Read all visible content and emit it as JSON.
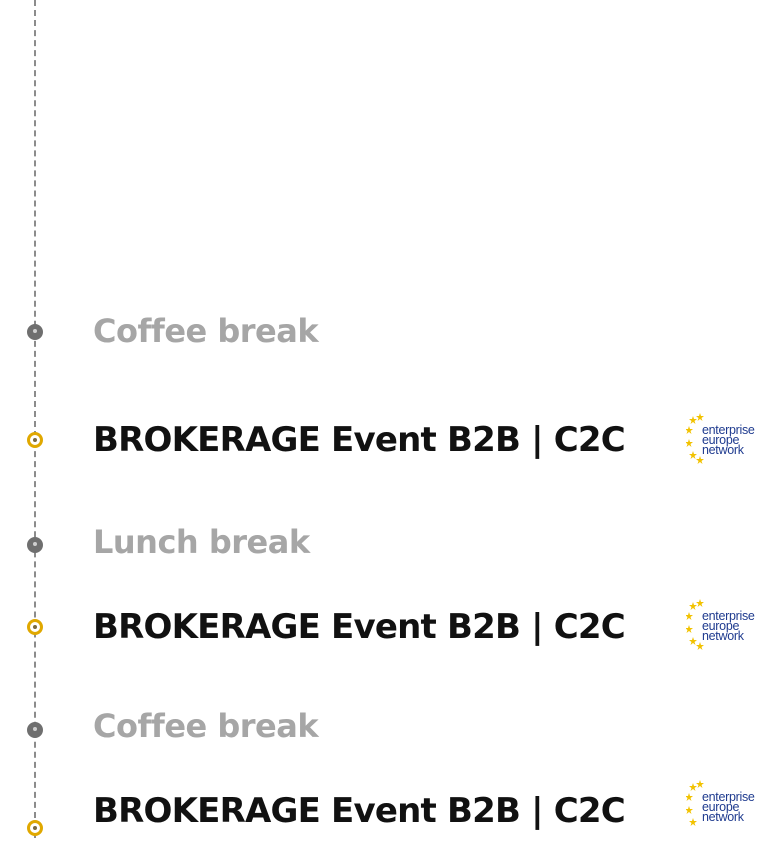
{
  "schedule": {
    "items": [
      {
        "type": "break",
        "title": "Coffee break"
      },
      {
        "type": "event",
        "title": "BROKERAGE Event B2B | C2C",
        "logo": {
          "name": "enterprise-europe-network-logo",
          "lines": [
            "enterprise",
            "europe",
            "network"
          ]
        }
      },
      {
        "type": "break",
        "title": "Lunch break"
      },
      {
        "type": "event",
        "title": "BROKERAGE Event B2B | C2C",
        "logo": {
          "name": "enterprise-europe-network-logo",
          "lines": [
            "enterprise",
            "europe",
            "network"
          ]
        }
      },
      {
        "type": "break",
        "title": "Coffee break"
      },
      {
        "type": "event",
        "title": "BROKERAGE Event B2B | C2C",
        "logo": {
          "name": "enterprise-europe-network-logo",
          "lines": [
            "enterprise",
            "europe",
            "network"
          ]
        }
      }
    ]
  },
  "colors": {
    "break_text": "#a6a6a6",
    "event_text": "#111111",
    "timeline": "#8c8c8c",
    "event_dot": "#e0a800",
    "logo_blue": "#1f3b8f",
    "logo_star": "#f2c200"
  }
}
